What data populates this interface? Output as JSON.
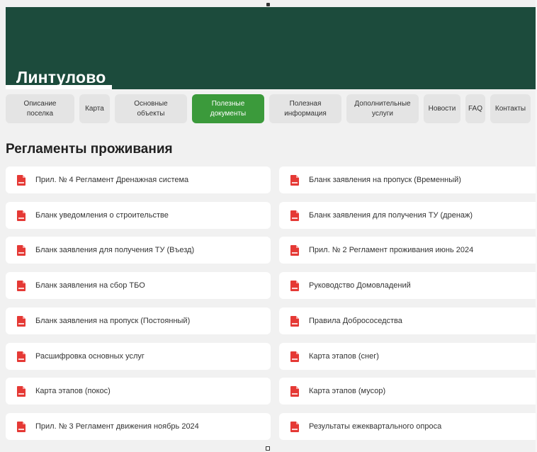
{
  "hero": {
    "title": "Линтулово",
    "bg": "#1c4b3c"
  },
  "tabs": [
    {
      "label": "Описание\nпоселка",
      "active": false
    },
    {
      "label": "Карта",
      "active": false
    },
    {
      "label": "Основные\nобъекты",
      "active": false
    },
    {
      "label": "Полезные\nдокументы",
      "active": true
    },
    {
      "label": "Полезная\nинформация",
      "active": false
    },
    {
      "label": "Дополнительные\nуслуги",
      "active": false
    },
    {
      "label": "Новости",
      "active": false
    },
    {
      "label": "FAQ",
      "active": false
    },
    {
      "label": "Контакты",
      "active": false
    }
  ],
  "section": {
    "title": "Регламенты проживания"
  },
  "documents": {
    "left": [
      "Прил. № 4 Регламент Дренажная система",
      "Бланк уведомления о строительстве",
      "Бланк заявления для получения ТУ (Въезд)",
      "Бланк заявления на сбор ТБО",
      "Бланк заявления на пропуск (Постоянный)",
      "Расшифровка основных услуг",
      "Карта этапов (покос)",
      "Прил. № 3 Регламент движения ноябрь 2024"
    ],
    "right": [
      "Бланк заявления на пропуск (Временный)",
      "Бланк заявления для получения ТУ (дренаж)",
      "Прил. № 2 Регламент проживания июнь 2024",
      "Руководство Домовладений",
      "Правила Добрососедства",
      "Карта этапов (снег)",
      "Карта этапов (мусор)",
      "Результаты ежеквартального опроса"
    ],
    "icon": "pdf-file-icon"
  },
  "colors": {
    "accent": "#3b9a3b",
    "pdf": "#e53935",
    "tab_bg": "#e4e4e4"
  }
}
